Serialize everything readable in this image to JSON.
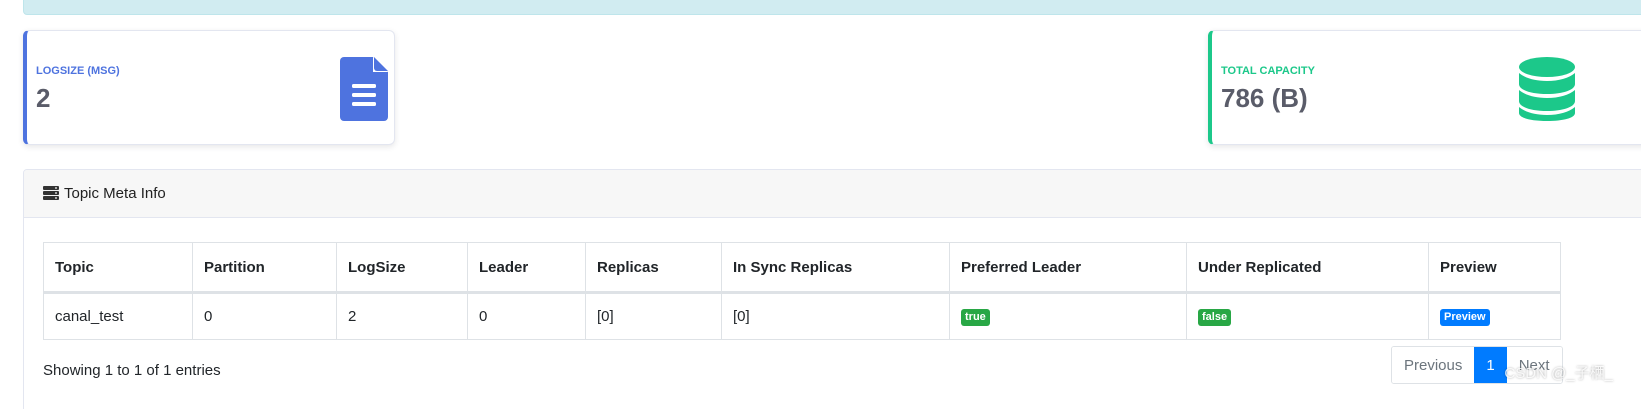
{
  "colors": {
    "primary": "#4e73df",
    "success": "#1cc88a",
    "badge_success": "#28a745",
    "badge_primary": "#007bff",
    "alert_bg": "#d1ecf1"
  },
  "cards": {
    "logsize": {
      "label": "LOGSIZE (MSG)",
      "value": "2",
      "icon": "file-document-icon"
    },
    "capacity": {
      "label": "TOTAL CAPACITY",
      "value": "786 (B)",
      "icon": "database-icon"
    }
  },
  "panel": {
    "title": "Topic Meta Info",
    "icon": "server-icon"
  },
  "table": {
    "headers": [
      "Topic",
      "Partition",
      "LogSize",
      "Leader",
      "Replicas",
      "In Sync Replicas",
      "Preferred Leader",
      "Under Replicated",
      "Preview"
    ],
    "rows": [
      {
        "topic": "canal_test",
        "partition": "0",
        "logsize": "2",
        "leader": "0",
        "replicas": "[0]",
        "isr": "[0]",
        "preferred_leader": "true",
        "under_replicated": "false",
        "preview": "Preview"
      }
    ]
  },
  "footer": {
    "info": "Showing 1 to 1 of 1 entries",
    "prev": "Previous",
    "page": "1",
    "next": "Next"
  },
  "watermark": "CSDN @_子栖_"
}
